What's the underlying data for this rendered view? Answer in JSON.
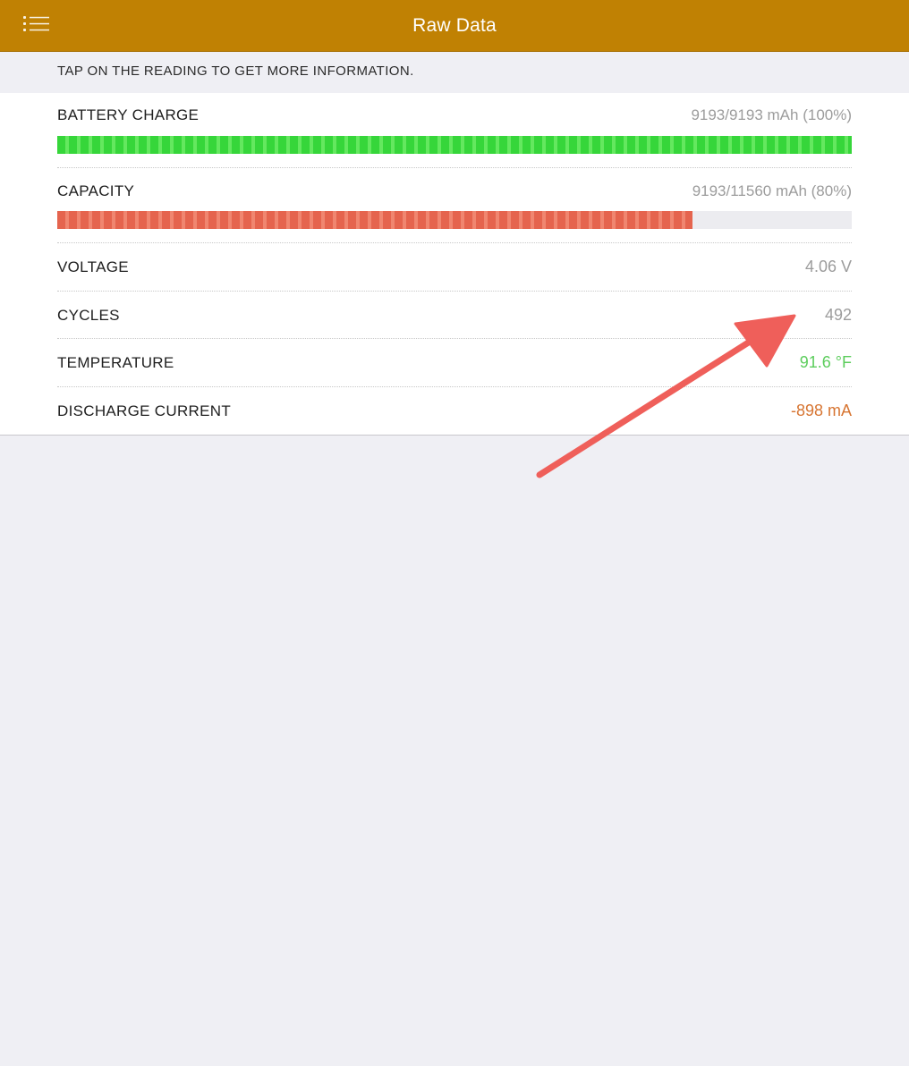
{
  "navbar": {
    "title": "Raw Data",
    "menu_icon": "list-menu-icon",
    "background_color": "#c08103"
  },
  "section_header": {
    "text": "TAP ON THE READING TO GET MORE INFORMATION."
  },
  "readings": {
    "battery_charge": {
      "label": "BATTERY CHARGE",
      "value": "9193/9193 mAh (100%)",
      "percent": 100,
      "bar_color": "#36d63a"
    },
    "capacity": {
      "label": "CAPACITY",
      "value": "9193/11560 mAh (80%)",
      "percent": 80,
      "bar_color": "#e5644e"
    },
    "voltage": {
      "label": "VOLTAGE",
      "value": "4.06 V"
    },
    "cycles": {
      "label": "CYCLES",
      "value": "492"
    },
    "temperature": {
      "label": "TEMPERATURE",
      "value": "91.6 °F",
      "value_color": "#5ccd5c"
    },
    "discharge_current": {
      "label": "DISCHARGE CURRENT",
      "value": "-898 mA",
      "value_color": "#d77532"
    }
  },
  "annotation": {
    "arrow_color": "#ef5f5a"
  }
}
